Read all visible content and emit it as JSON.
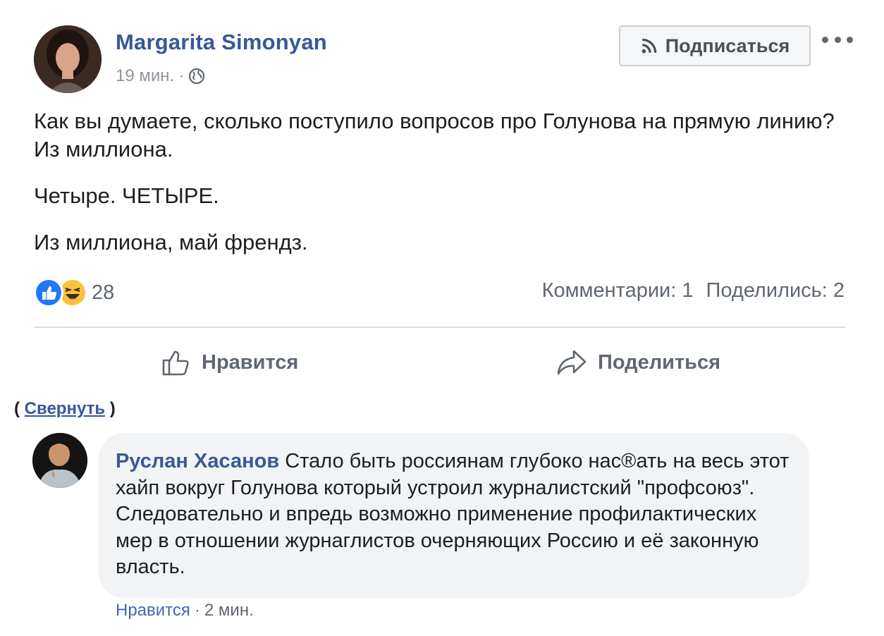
{
  "post": {
    "author": "Margarita Simonyan",
    "time": "19 мин.",
    "separator": "·",
    "follow_label": "Подписаться",
    "paragraphs": [
      "Как вы думаете, сколько поступило вопросов про Голунова на прямую линию? Из миллиона.",
      "Четыре. ЧЕТЫРЕ.",
      "Из миллиона, май френдз."
    ],
    "reaction_count": "28",
    "comments_label": "Комментарии: 1",
    "shares_label": "Поделились: 2",
    "like_action": "Нравится",
    "share_action": "Поделиться",
    "collapse_open": "(",
    "collapse_label": "Свернуть",
    "collapse_close": ")"
  },
  "comment": {
    "author": "Руслан Хасанов",
    "text": "Стало быть россиянам глубоко нас®ать на весь этот хайп вокруг Голунова который устроил журналистский \"профсоюз\". Следовательно и впредь возможно применение профилактических мер в отношении журнаглистов очерняющих Россию и её законную власть.",
    "like_label": "Нравится",
    "separator": "·",
    "time": "2 мин."
  },
  "colors": {
    "link_blue": "#385898",
    "like_blue": "#2078f4",
    "haha_yellow": "#f7c33b",
    "bubble_gray": "#f2f3f5"
  },
  "icons": [
    "globe-icon",
    "rss-icon",
    "more-icon",
    "like-reaction-icon",
    "haha-reaction-icon",
    "thumbs-up-icon",
    "share-arrow-icon"
  ]
}
